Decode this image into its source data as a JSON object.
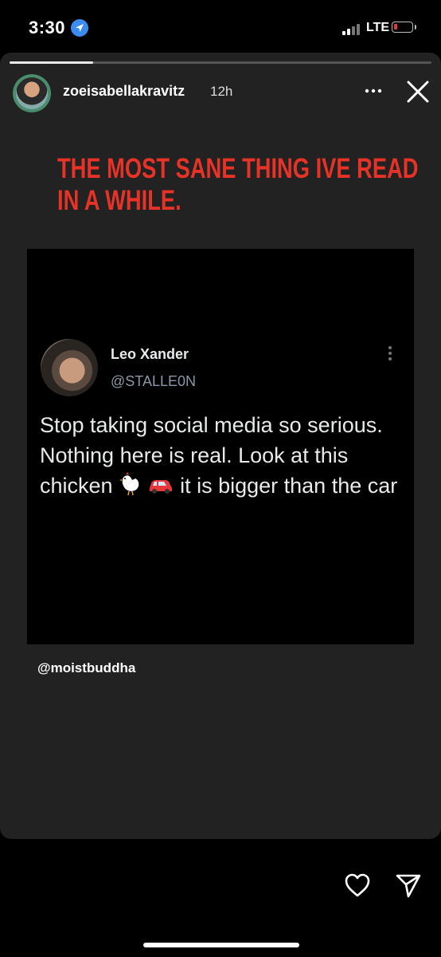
{
  "status_bar": {
    "time": "3:30",
    "network": "LTE",
    "location_icon": "location-arrow-icon",
    "battery_color": "#e53935"
  },
  "story": {
    "username": "zoeisabellakravitz",
    "age": "12h",
    "progress": 0.2,
    "headline": "THE MOST SANE THING IVE READ IN A WHILE.",
    "headline_color": "#e73227",
    "mention": "@moistbuddha"
  },
  "tweet": {
    "name": "Leo Xander",
    "handle": "@STALLE0N",
    "text_1": "Stop taking social media so serious. Nothing here is real. Look at this chicken",
    "text_2": "it is bigger than the car",
    "emojis": [
      "chicken",
      "car"
    ]
  },
  "bottom_bar": {
    "icons": [
      "heart-icon",
      "send-icon"
    ]
  }
}
